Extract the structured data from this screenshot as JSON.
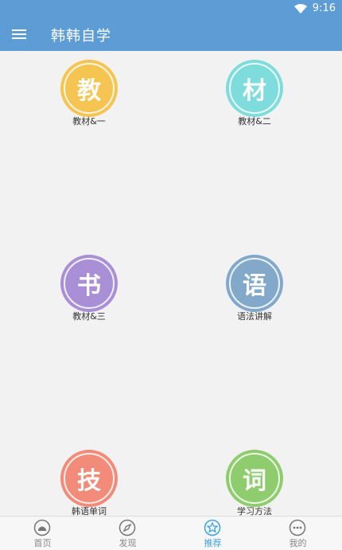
{
  "status_bar": {
    "time": "9:16",
    "wifi_icon": "wifi-icon"
  },
  "app_bar": {
    "menu_icon": "menu-icon",
    "title": "韩韩自学"
  },
  "tiles": [
    {
      "glyph": "教",
      "label": "教材&一",
      "color": "#f5c451"
    },
    {
      "glyph": "材",
      "label": "教材&二",
      "color": "#7fdcdc"
    },
    {
      "glyph": "书",
      "label": "教材&三",
      "color": "#a98fd6"
    },
    {
      "glyph": "语",
      "label": "语法讲解",
      "color": "#82a9c9"
    },
    {
      "glyph": "技",
      "label": "韩语单词",
      "color": "#f28b79"
    },
    {
      "glyph": "词",
      "label": "学习方法",
      "color": "#8fcc6d"
    }
  ],
  "bottom_nav": [
    {
      "label": "首页",
      "icon": "home-icon",
      "active": false
    },
    {
      "label": "发现",
      "icon": "compass-icon",
      "active": false
    },
    {
      "label": "推荐",
      "icon": "star-icon",
      "active": true
    },
    {
      "label": "我的",
      "icon": "more-icon",
      "active": false
    }
  ],
  "colors": {
    "primary": "#5e9cd6",
    "active_tab": "#3ea2e5",
    "inactive_tab": "#888888"
  }
}
